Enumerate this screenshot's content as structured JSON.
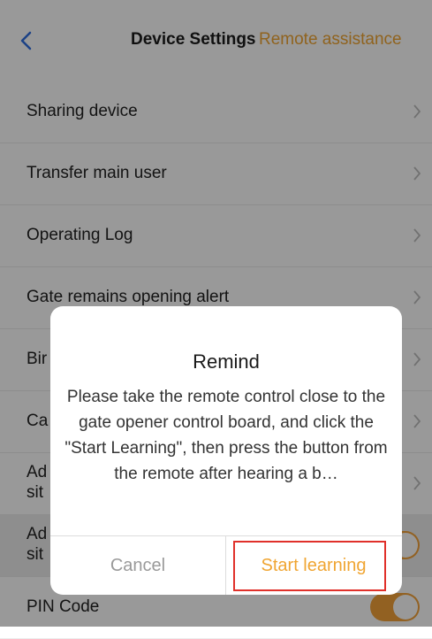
{
  "header": {
    "title": "Device Settings",
    "remote_link": "Remote assistance"
  },
  "settings": {
    "sharing": "Sharing device",
    "transfer": "Transfer main user",
    "log": "Operating Log",
    "gate_alert": "Gate remains opening alert",
    "row5": "Bir",
    "row6": "Ca",
    "row7": "Ad\nsit",
    "row8": "Ad\nsit",
    "pin": "PIN Code"
  },
  "dialog": {
    "title": "Remind",
    "message": "Please take the remote control close to the gate opener control board, and click the \"Start Learning\", then press the button from the remote after hearing a b…",
    "cancel_label": "Cancel",
    "start_label": "Start learning"
  },
  "colors": {
    "accent": "#f0a532",
    "highlight": "#e0302a"
  }
}
